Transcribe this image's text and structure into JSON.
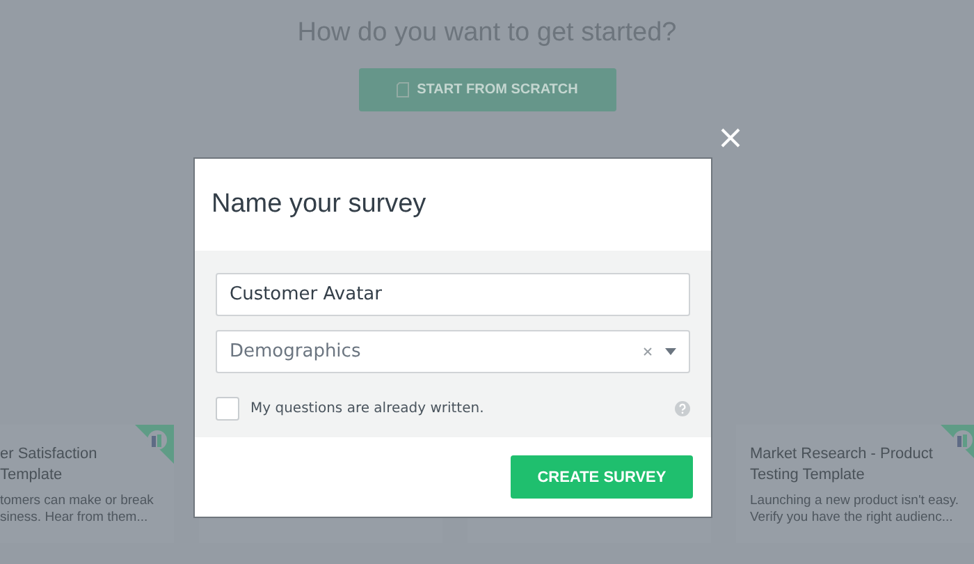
{
  "page": {
    "heading": "How do you want to get started?",
    "start_button": "START FROM SCRATCH"
  },
  "template_cards": [
    {
      "title_lines": [
        "er Satisfaction",
        "Template"
      ],
      "description_lines": [
        "tomers can make or break",
        "siness. Hear from them..."
      ]
    },
    {
      "title_lines": [
        "Market Research - Product",
        "Testing Template"
      ],
      "description_lines": [
        "Launching a new product isn't easy.",
        "Verify you have the right audienc..."
      ]
    }
  ],
  "dialog": {
    "title": "Name your survey",
    "name_field": {
      "value": "Customer Avatar"
    },
    "category_select": {
      "value": "Demographics"
    },
    "questions_written": {
      "label": "My questions are already written.",
      "checked": false
    },
    "create_button": "CREATE SURVEY"
  }
}
